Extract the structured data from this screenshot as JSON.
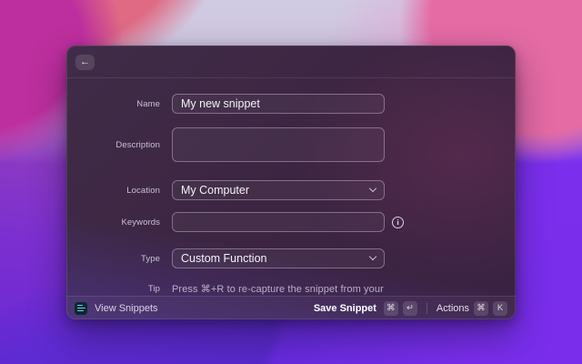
{
  "window": {
    "header": {
      "back_icon": "←"
    },
    "form": {
      "fields": [
        {
          "label": "Name",
          "type": "text",
          "value": "My new snippet"
        },
        {
          "label": "Description",
          "type": "textarea",
          "value": ""
        },
        {
          "label": "Location",
          "type": "select",
          "value": "My Computer"
        },
        {
          "label": "Keywords",
          "type": "text",
          "value": "",
          "has_info_icon": true
        },
        {
          "label": "Type",
          "type": "select",
          "value": "Custom Function"
        }
      ],
      "tip": {
        "label": "Tip",
        "text": "Press ⌘+R to re-capture the snippet from your"
      }
    },
    "footer": {
      "left": {
        "icon": "snippets-icon",
        "label": "View Snippets"
      },
      "primary_action": {
        "label": "Save Snippet",
        "keys": [
          "⌘",
          "↵"
        ]
      },
      "secondary_action": {
        "label": "Actions",
        "keys": [
          "⌘",
          "K"
        ]
      }
    },
    "icons": {
      "info_glyph": "i"
    }
  },
  "colors": {
    "snippets_icon_accent": "#4fd8e8",
    "window_base": "#3c2542",
    "field_border": "rgba(255,255,255,0.32)"
  }
}
